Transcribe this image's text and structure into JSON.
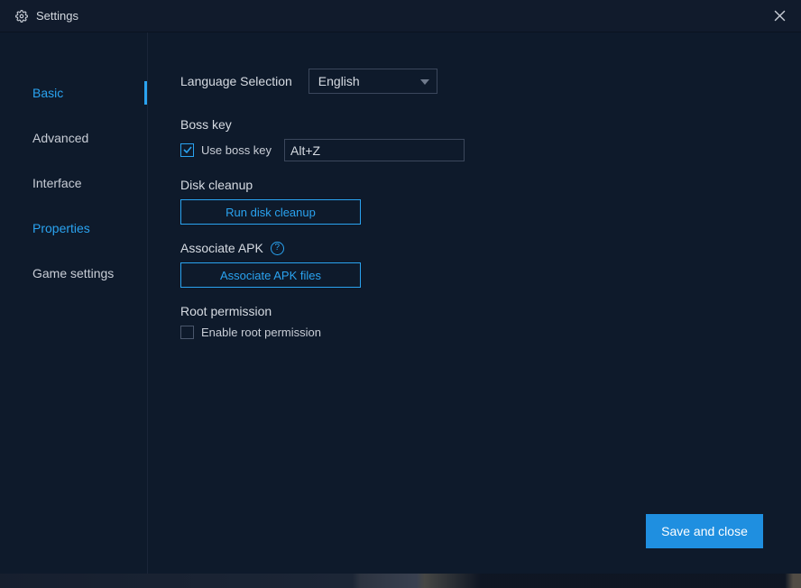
{
  "window": {
    "title": "Settings"
  },
  "sidebar": {
    "items": [
      {
        "label": "Basic"
      },
      {
        "label": "Advanced"
      },
      {
        "label": "Interface"
      },
      {
        "label": "Properties"
      },
      {
        "label": "Game settings"
      }
    ]
  },
  "main": {
    "language": {
      "label": "Language Selection",
      "value": "English"
    },
    "boss_key": {
      "section_label": "Boss key",
      "checkbox_label": "Use boss key",
      "checked": true,
      "hotkey_value": "Alt+Z"
    },
    "disk_cleanup": {
      "section_label": "Disk cleanup",
      "button_label": "Run disk cleanup"
    },
    "associate_apk": {
      "section_label": "Associate APK",
      "button_label": "Associate APK files"
    },
    "root": {
      "section_label": "Root permission",
      "checkbox_label": "Enable root permission",
      "checked": false
    }
  },
  "footer": {
    "save_label": "Save and close"
  }
}
